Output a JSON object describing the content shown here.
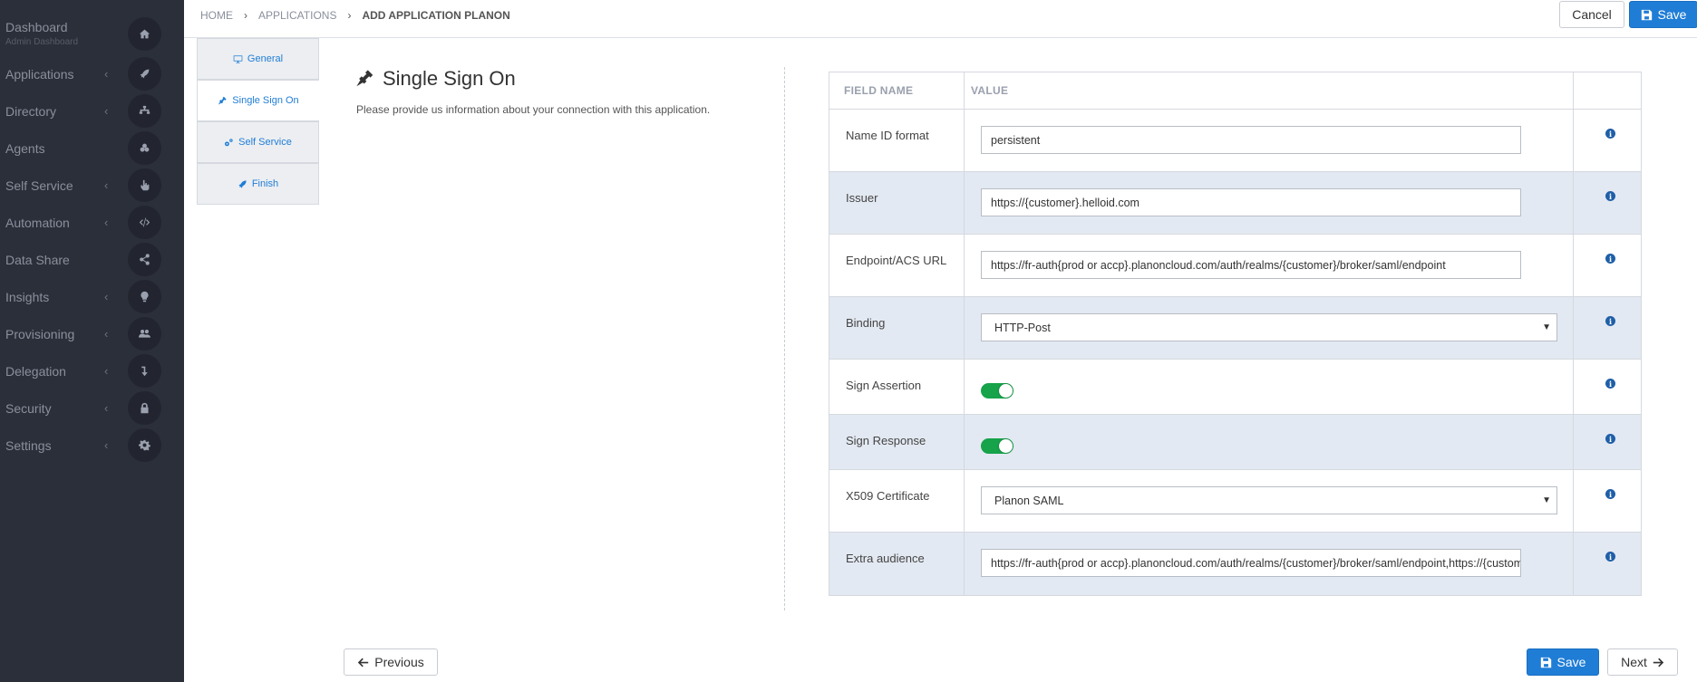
{
  "sidebar": {
    "items": [
      {
        "label": "Dashboard",
        "sub": "Admin Dashboard",
        "icon": "home-icon",
        "chevron": ""
      },
      {
        "label": "Applications",
        "icon": "rocket-icon",
        "chevron": "‹"
      },
      {
        "label": "Directory",
        "icon": "sitemap-icon",
        "chevron": "‹"
      },
      {
        "label": "Agents",
        "icon": "cubes-icon",
        "chevron": ""
      },
      {
        "label": "Self Service",
        "icon": "hand-pointer-icon",
        "chevron": "‹"
      },
      {
        "label": "Automation",
        "icon": "code-icon",
        "chevron": "‹"
      },
      {
        "label": "Data Share",
        "icon": "share-icon",
        "chevron": ""
      },
      {
        "label": "Insights",
        "icon": "lightbulb-icon",
        "chevron": "‹"
      },
      {
        "label": "Provisioning",
        "icon": "users-icon",
        "chevron": "‹"
      },
      {
        "label": "Delegation",
        "icon": "level-down-icon",
        "chevron": "‹"
      },
      {
        "label": "Security",
        "icon": "lock-icon",
        "chevron": "‹"
      },
      {
        "label": "Settings",
        "icon": "gear-icon",
        "chevron": "‹"
      }
    ]
  },
  "breadcrumb": {
    "home": "HOME",
    "applications": "APPLICATIONS",
    "current": "ADD APPLICATION PLANON",
    "sep": "›"
  },
  "topbar": {
    "cancel_label": "Cancel",
    "save_label": "Save"
  },
  "steps": [
    {
      "label": "General",
      "icon": "desktop-icon"
    },
    {
      "label": "Single Sign On",
      "icon": "plug-icon"
    },
    {
      "label": "Self Service",
      "icon": "cogs-icon"
    },
    {
      "label": "Finish",
      "icon": "rocket-icon"
    }
  ],
  "section": {
    "title": "Single Sign On",
    "description": "Please provide us information about your connection with this application."
  },
  "table": {
    "headers": {
      "field_name": "FIELD NAME",
      "value": "VALUE"
    },
    "rows": [
      {
        "name": "Name ID format",
        "type": "input",
        "value": "persistent"
      },
      {
        "name": "Issuer",
        "type": "input",
        "value": "https://{customer}.helloid.com"
      },
      {
        "name": "Endpoint/ACS URL",
        "type": "input",
        "value": "https://fr-auth{prod or accp}.planoncloud.com/auth/realms/{customer}/broker/saml/endpoint"
      },
      {
        "name": "Binding",
        "type": "select",
        "value": "HTTP-Post"
      },
      {
        "name": "Sign Assertion",
        "type": "toggle",
        "value": "on"
      },
      {
        "name": "Sign Response",
        "type": "toggle",
        "value": "on"
      },
      {
        "name": "X509 Certificate",
        "type": "select",
        "value": "Planon SAML"
      },
      {
        "name": "Extra audience",
        "type": "input",
        "value": "https://fr-auth{prod or accp}.planoncloud.com/auth/realms/{customer}/broker/saml/endpoint,https://{customer}"
      }
    ]
  },
  "footer": {
    "previous_label": "Previous",
    "save_label": "Save",
    "next_label": "Next"
  },
  "colors": {
    "sidebar_bg": "#2b2f3a",
    "primary": "#1f7dd6",
    "toggle_on": "#16a34a",
    "row_alt": "#e3e9f2"
  }
}
